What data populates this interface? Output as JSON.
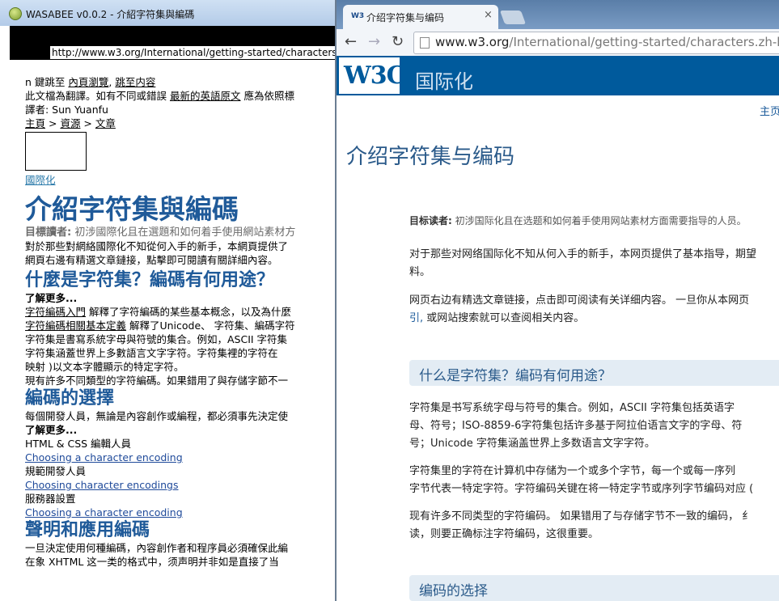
{
  "left_window": {
    "title": "WASABEE v0.0.2 - 介紹字符集與編碼",
    "url": "http://www.w3.org/International/getting-started/characters",
    "nav_line": {
      "prefix": "n 鍵跳至 ",
      "link1": "內頁瀏覽",
      "sep": ", ",
      "link2": "跳至内容"
    },
    "translation_note": {
      "text1": "此文檔為翻譯。如有不同或錯誤 ",
      "link": "最新的英語原文",
      "text2": " 應為依照標"
    },
    "translator": "譯者: Sun Yuanfu",
    "breadcrumb": {
      "home": "主頁",
      "sep1": " > ",
      "resources": "資源",
      "sep2": " > ",
      "articles": "文章"
    },
    "i18n_link": "國際化",
    "page_title": "介紹字符集與編碼",
    "audience": {
      "label": "目標讀者:",
      "text": " 初涉國際化且在選題和如何着手使用網站素材方"
    },
    "intro_lines": [
      "對於那些對網絡國際化不知從何入手的新手，本網頁提供了",
      "網頁右邊有精選文章鏈接，點擊即可閱讀有關詳細內容。"
    ],
    "section1_title": "什麼是字符集？編碼有何用途？",
    "learn_more1": "了解更多...",
    "s1_lines": [
      {
        "link": "字符編碼入門",
        "text": " 解釋了字符編碼的某些基本概念，以及為什麼"
      },
      {
        "link": "字符編碼相關基本定義",
        "text": " 解釋了Unicode、 字符集、編碼字符"
      }
    ],
    "s1_text_lines": [
      "字符集是書寫系統字母與符號的集合。例如，ASCII 字符集",
      "字符集涵蓋世界上多數語言文字字符。字符集裡的字符在",
      "映射 )以文本字體顯示的特定字符。",
      "現有許多不同類型的字符編碼。如果錯用了與存儲字節不一"
    ],
    "section2_title": "編碼的選擇",
    "s2_line": "每個開發人員，無論是內容創作或編程，都必須事先決定使",
    "learn_more2": "了解更多...",
    "resources": [
      {
        "role": "HTML & CSS 編輯人員",
        "link": "Choosing a character encoding"
      },
      {
        "role": "規範開發人員",
        "link": "Choosing character encodings"
      },
      {
        "role": "服務器設置",
        "link": "Choosing a character encoding"
      }
    ],
    "section3_title": "聲明和應用編碼",
    "s3_lines": [
      "一旦決定使用何種編碼，內容創作者和程序員必須確保此編",
      "在象 XHTML 这一类的格式中，须声明并非如是直接了当"
    ]
  },
  "right_window": {
    "tab_title": "介绍字符集与编码",
    "tab_favicon": "W3",
    "tab_close": "×",
    "nav": {
      "back": "←",
      "forward": "→",
      "reload": "↻"
    },
    "url": {
      "host": "www.w3.org",
      "path": "/International/getting-started/characters.zh-hans"
    },
    "logo_text": "W3C",
    "banner_title": "国际化",
    "home_link": "主页",
    "page_title": "介绍字符集与编码",
    "audience": {
      "label": "目标读者:",
      "text": " 初涉国际化且在选题和如何着手使用网站素材方面需要指导的人员。"
    },
    "para1": [
      "对于那些对网络国际化不知从何入手的新手，本网页提供了基本指导，期望",
      "料。"
    ],
    "para2": {
      "line1": "网页右边有精选文章链接，点击即可阅读有关详细内容。 一旦你从本网页",
      "link": "引,",
      "line2rest": " 或网站搜索就可以查阅相关内容。"
    },
    "section1_title": "什么是字符集？编码有何用途？",
    "s1_p1": [
      "字符集是书写系统字母与符号的集合。例如，ASCII  字符集包括英语字",
      "母、符号；ISO-8859-6字符集包括许多基于阿拉伯语言文字的字母、符",
      "号；Unicode 字符集涵盖世界上多数语言文字字符。"
    ],
    "s1_p2": [
      "字符集里的字符在计算机中存储为一个或多个字节，每一个或每一序列",
      "字节代表一特定字符。字符编码关键在将一特定字节或序列字节编码对应 ("
    ],
    "s1_p3": [
      "现有许多不同类型的字符编码。 如果错用了与存储字节不一致的编码，  纟",
      "读，则要正确标注字符编码，这很重要。"
    ],
    "section2_title": "编码的选择"
  },
  "colors": {
    "left_heading": "#1f5a99",
    "w3c_blue": "#005a9c",
    "section_bg": "#e3ecf4"
  }
}
